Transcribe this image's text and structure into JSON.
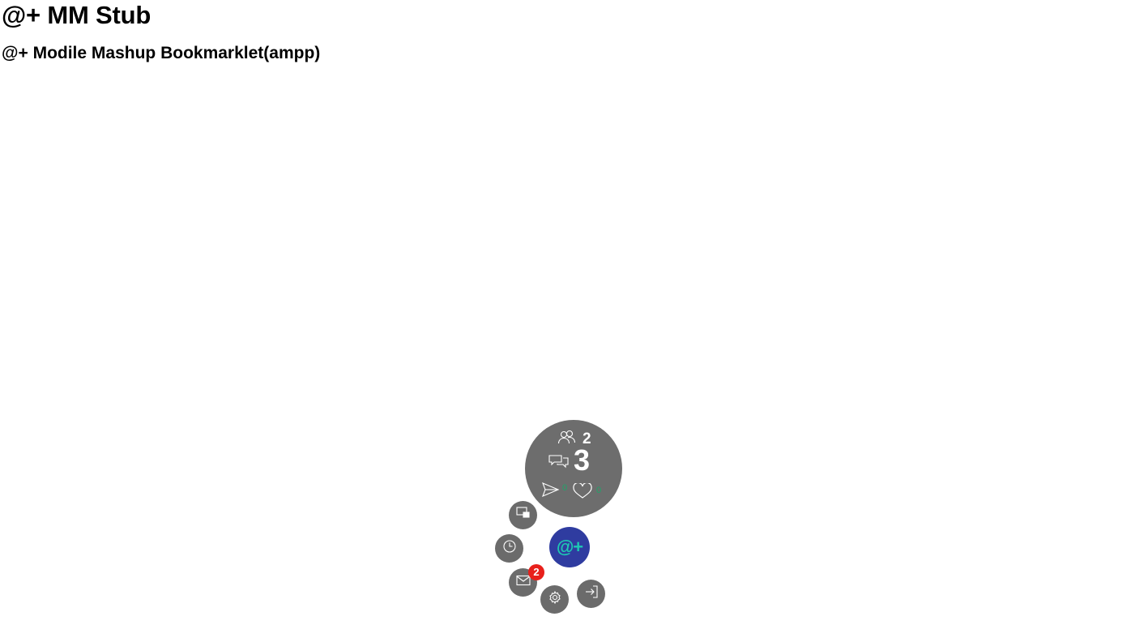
{
  "page": {
    "title": "@+ MM Stub",
    "subtitle": "@+ Modile Mashup Bookmarklet(ampp)"
  },
  "widget": {
    "users_count": "2",
    "comments_count": "3",
    "sent_count": "0",
    "likes_count": "0",
    "main_button_label": "@+",
    "mail_badge_count": "2",
    "icons": {
      "users": "users-icon",
      "chat": "chat-icon",
      "send": "send-icon",
      "heart": "heart-icon",
      "window": "window-icon",
      "clock": "clock-icon",
      "mail": "mail-icon",
      "settings": "gear-icon",
      "exit": "exit-icon"
    },
    "colors": {
      "panel": "#6d6d6d",
      "button": "#6b6b6b",
      "main_button": "#2f3ca0",
      "logo": "#1ec9b3",
      "counter_green": "#1fa56a",
      "badge": "#e8201b"
    }
  }
}
